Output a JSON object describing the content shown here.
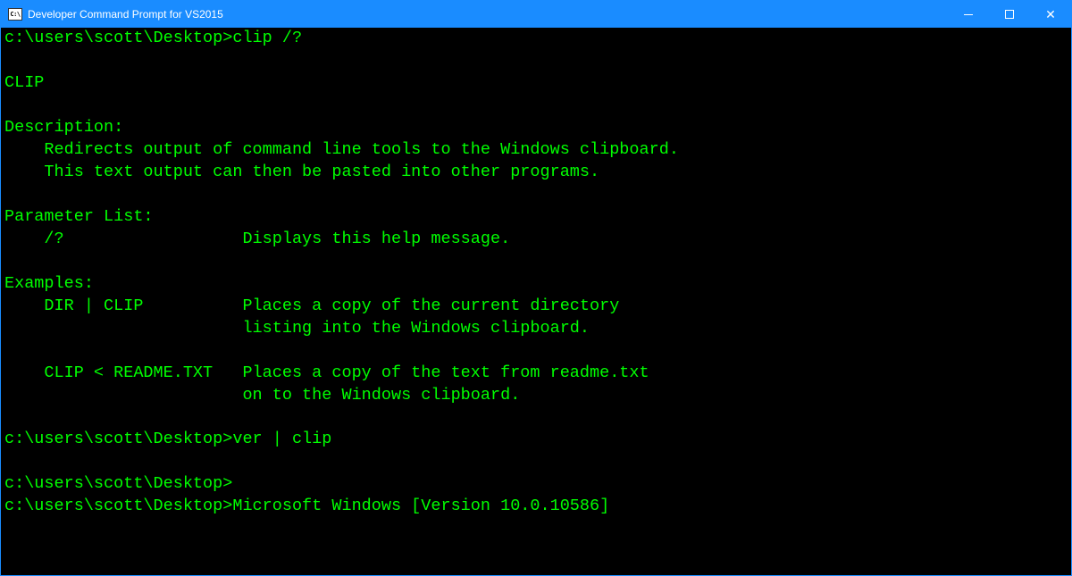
{
  "window": {
    "title": "Developer Command Prompt for VS2015",
    "icon_label": "C:\\"
  },
  "terminal": {
    "lines": [
      "c:\\users\\scott\\Desktop>clip /?",
      "",
      "CLIP",
      "",
      "Description:",
      "    Redirects output of command line tools to the Windows clipboard.",
      "    This text output can then be pasted into other programs.",
      "",
      "Parameter List:",
      "    /?                  Displays this help message.",
      "",
      "Examples:",
      "    DIR | CLIP          Places a copy of the current directory",
      "                        listing into the Windows clipboard.",
      "",
      "    CLIP < README.TXT   Places a copy of the text from readme.txt",
      "                        on to the Windows clipboard.",
      "",
      "c:\\users\\scott\\Desktop>ver | clip",
      "",
      "c:\\users\\scott\\Desktop>",
      "c:\\users\\scott\\Desktop>Microsoft Windows [Version 10.0.10586]"
    ]
  },
  "colors": {
    "titlebar_bg": "#1a8cff",
    "terminal_bg": "#000000",
    "terminal_fg": "#00ff00"
  }
}
